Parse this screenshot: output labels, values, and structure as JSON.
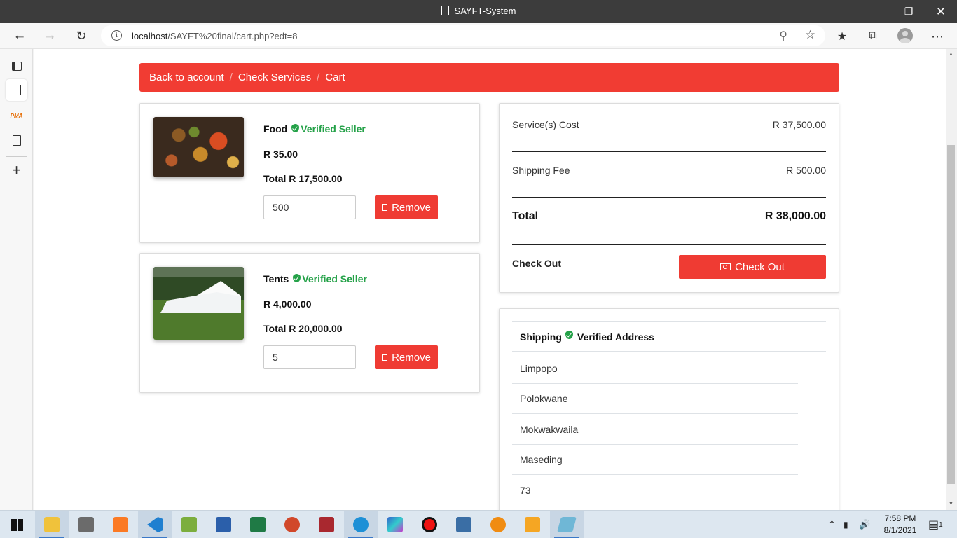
{
  "window": {
    "title": "SAYFT-System"
  },
  "browser": {
    "url_host": "localhost",
    "url_path": "/SAYFT%20final/cart.php?edt=8"
  },
  "breadcrumb": {
    "items": [
      "Back to account",
      "Check Services",
      "Cart"
    ],
    "separator": "/"
  },
  "cart": {
    "items": [
      {
        "name": "Food",
        "badge": "Verified Seller",
        "price": "R 35.00",
        "total": "Total R 17,500.00",
        "quantity": "500",
        "remove_label": "Remove",
        "image": "food-spread-photo"
      },
      {
        "name": "Tents",
        "badge": "Verified Seller",
        "price": "R 4,000.00",
        "total": "Total R 20,000.00",
        "quantity": "5",
        "remove_label": "Remove",
        "image": "white-tent-photo"
      }
    ]
  },
  "summary": {
    "service_cost_label": "Service(s) Cost",
    "service_cost_value": "R 37,500.00",
    "shipping_fee_label": "Shipping Fee",
    "shipping_fee_value": "R 500.00",
    "total_label": "Total",
    "total_value": "R 38,000.00",
    "checkout_label": "Check Out",
    "checkout_button": "Check Out"
  },
  "shipping": {
    "header_label": "Shipping",
    "header_status": "Verified Address",
    "lines": [
      "Limpopo",
      "Polokwane",
      "Mokwakwaila",
      "Maseding",
      "73"
    ]
  },
  "taskbar": {
    "time": "7:58 PM",
    "date": "8/1/2021",
    "notification_count": "1"
  },
  "colors": {
    "brand_red": "#f13c33",
    "verified_green": "#24a148",
    "titlebar": "#3c3c3c"
  }
}
